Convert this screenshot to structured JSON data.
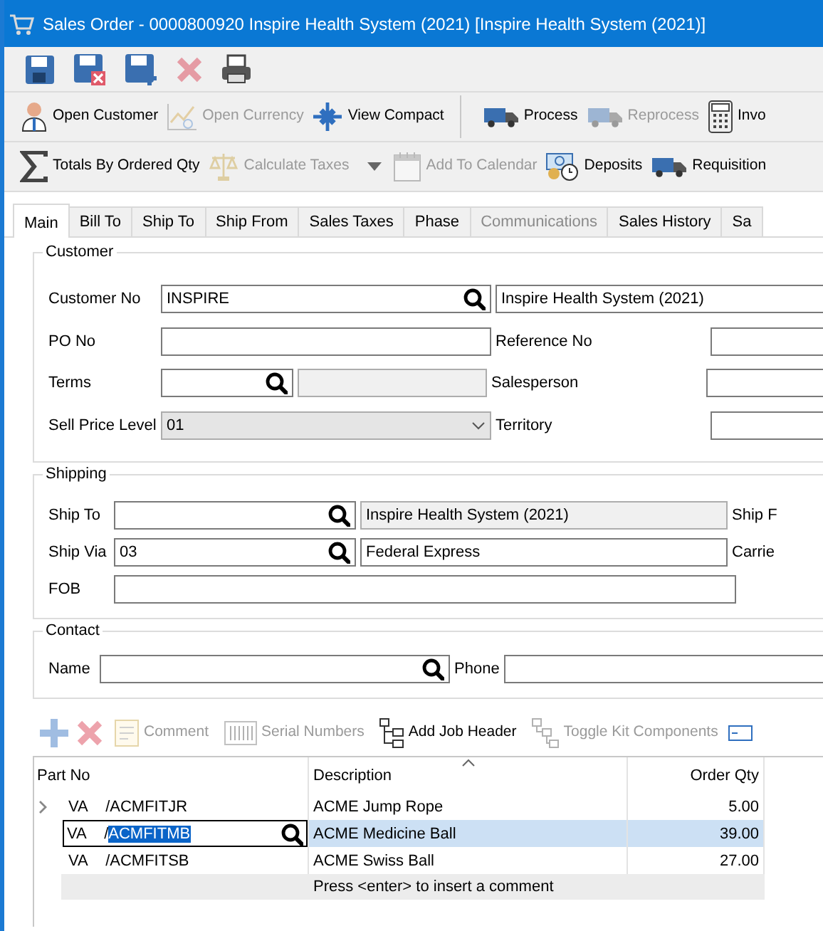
{
  "window": {
    "title": "Sales Order - 0000800920 Inspire Health System (2021) [Inspire Health System (2021)]"
  },
  "toolbar_1": [
    {
      "kind": "save",
      "disabled": false
    },
    {
      "kind": "save_close",
      "disabled": false
    },
    {
      "kind": "save_new",
      "disabled": false
    },
    {
      "kind": "delete",
      "disabled": true
    },
    {
      "kind": "print",
      "disabled": false
    }
  ],
  "toolbar_2": [
    {
      "items": [
        {
          "kind": "customer",
          "label": "Open Customer",
          "disabled": false
        },
        {
          "kind": "currency",
          "label": "Open Currency",
          "disabled": true
        },
        {
          "kind": "compact",
          "label": "View Compact",
          "disabled": false
        }
      ]
    },
    {
      "items": [
        {
          "kind": "truck",
          "label": "Process",
          "disabled": false
        },
        {
          "kind": "truck",
          "label": "Reprocess",
          "disabled": true
        },
        {
          "kind": "calculator",
          "label": "Invo",
          "disabled": false
        }
      ]
    }
  ],
  "toolbar_3": [
    {
      "kind": "sigma",
      "label": "Totals By Ordered Qty",
      "disabled": false,
      "dropdown": false
    },
    {
      "kind": "scale",
      "label": "Calculate Taxes",
      "disabled": true,
      "dropdown": true
    },
    {
      "kind": "calendar",
      "label": "Add To Calendar",
      "disabled": true,
      "dropdown": false
    },
    {
      "kind": "money",
      "label": "Deposits",
      "disabled": false,
      "dropdown": false
    },
    {
      "kind": "truck",
      "label": "Requisition",
      "disabled": false,
      "dropdown": false
    }
  ],
  "tabs": [
    {
      "label": "Main",
      "selected": true,
      "disabled": false
    },
    {
      "label": "Bill To",
      "selected": false,
      "disabled": false
    },
    {
      "label": "Ship To",
      "selected": false,
      "disabled": false
    },
    {
      "label": "Ship From",
      "selected": false,
      "disabled": false
    },
    {
      "label": "Sales Taxes",
      "selected": false,
      "disabled": false
    },
    {
      "label": "Phase",
      "selected": false,
      "disabled": false
    },
    {
      "label": "Communications",
      "selected": false,
      "disabled": true
    },
    {
      "label": "Sales History",
      "selected": false,
      "disabled": false
    },
    {
      "label": "Sa",
      "selected": false,
      "disabled": false
    }
  ],
  "customer": {
    "title": "Customer",
    "customer_no": {
      "label": "Customer No",
      "value": "INSPIRE",
      "name": "Inspire Health System (2021)"
    },
    "po_no": {
      "label": "PO No"
    },
    "reference_no": {
      "label": "Reference No"
    },
    "terms": {
      "label": "Terms"
    },
    "salesperson": {
      "label": "Salesperson"
    },
    "sell_price_level": {
      "label": "Sell Price Level",
      "value": "01"
    },
    "territory": {
      "label": "Territory"
    }
  },
  "shipping": {
    "title": "Shipping",
    "ship_to": {
      "label": "Ship To",
      "name": "Inspire Health System (2021)"
    },
    "ship_from_label": "Ship F",
    "ship_via": {
      "label": "Ship Via",
      "value": "03",
      "name": "Federal Express"
    },
    "carrier_label": "Carrie",
    "fob": {
      "label": "FOB"
    }
  },
  "contact": {
    "title": "Contact",
    "name": {
      "label": "Name"
    },
    "phone": {
      "label": "Phone"
    }
  },
  "lines_toolbar": [
    {
      "kind": "add",
      "disabled": true
    },
    {
      "kind": "delete",
      "disabled": true
    },
    {
      "kind": "comment",
      "label": "Comment",
      "disabled": true
    },
    {
      "kind": "serial",
      "label": "Serial Numbers",
      "disabled": true
    },
    {
      "kind": "job",
      "label": "Add Job Header",
      "disabled": false
    },
    {
      "kind": "kit",
      "label": "Toggle Kit Components",
      "disabled": true
    },
    {
      "kind": "more",
      "disabled": false
    }
  ],
  "grid": {
    "columns": [
      {
        "label": "Part No",
        "sorted": false
      },
      {
        "label": "Description",
        "sorted": true
      },
      {
        "label": "Order Qty",
        "sorted": false
      }
    ],
    "rows": [
      {
        "expandable": true,
        "warehouse": "VA",
        "separator": "/",
        "part": "ACMFITJR",
        "description": "ACME Jump Rope",
        "qty": "5.00",
        "selected": false,
        "editing": false
      },
      {
        "expandable": false,
        "warehouse": "VA",
        "separator": "/",
        "part": "ACMFITMB",
        "description": "ACME Medicine Ball",
        "qty": "39.00",
        "selected": true,
        "editing": true
      },
      {
        "expandable": false,
        "warehouse": "VA",
        "separator": "/",
        "part": "ACMFITSB",
        "description": "ACME Swiss Ball",
        "qty": "27.00",
        "selected": false,
        "editing": false
      }
    ],
    "comment_row": "Press <enter> to insert a comment"
  }
}
